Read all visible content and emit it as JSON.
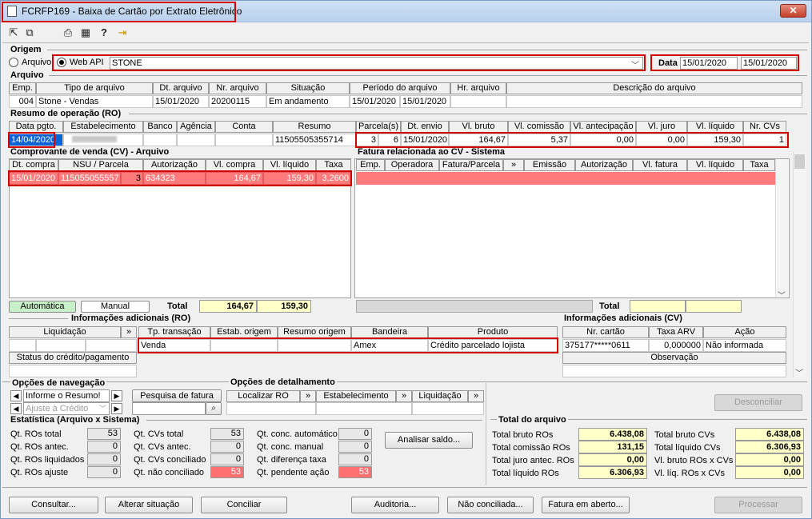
{
  "window": {
    "title": "FCRFP169 - Baixa de Cartão por Extrato Eletrônico",
    "close": "✕"
  },
  "toolbar": {
    "icons": [
      "export-icon",
      "copy-icon",
      "print-icon",
      "calendar-icon",
      "help-icon",
      "exit-icon"
    ]
  },
  "origem": {
    "label": "Origem",
    "opt_arquivo": "Arquivo",
    "opt_webapi": "Web API",
    "webapi_value": "STONE",
    "data_label": "Data",
    "data_from": "15/01/2020",
    "data_to": "15/01/2020"
  },
  "arquivo": {
    "label": "Arquivo",
    "headers": [
      "Emp.",
      "Tipo de arquivo",
      "Dt. arquivo",
      "Nr. arquivo",
      "Situação",
      "Período do arquivo",
      "Hr. arquivo",
      "Descrição do arquivo"
    ],
    "row": {
      "emp": "004",
      "tipo": "Stone - Vendas",
      "dt": "15/01/2020",
      "nr": "20200115",
      "situacao": "Em andamento",
      "periodo_de": "15/01/2020",
      "periodo_ate": "15/01/2020",
      "hr": "",
      "descricao": ""
    }
  },
  "resumo": {
    "label": "Resumo de operação (RO)",
    "headers": [
      "Data pgto.",
      "Estabelecimento",
      "Banco",
      "Agência",
      "Conta",
      "Resumo",
      "Parcela(s)",
      "Dt. envio",
      "Vl. bruto",
      "Vl. comissão",
      "Vl. antecipação",
      "Vl. juro",
      "Vl. líquido",
      "Nr. CVs"
    ],
    "row": {
      "data": "14/04/2020",
      "estab": "",
      "banco": "",
      "agencia": "",
      "conta": "",
      "resumo": "11505505355714",
      "parc1": "3",
      "parc2": "6",
      "envio": "15/01/2020",
      "bruto": "164,67",
      "comissao": "5,37",
      "antecipacao": "0,00",
      "juro": "0,00",
      "liquido": "159,30",
      "ncvs": "1"
    }
  },
  "cv": {
    "label": "Comprovante de venda (CV) - Arquivo",
    "headers": [
      "Dt. compra",
      "NSU / Parcela",
      "Autorização",
      "Vl. compra",
      "Vl. líquido",
      "Taxa"
    ],
    "row": {
      "compra": "15/01/2020",
      "nsu": "115055055557",
      "parcela": "3",
      "autorizacao": "634323",
      "vl_compra": "164,67",
      "vl_liquido": "159,30",
      "taxa": "3,2600"
    },
    "btn_auto": "Automática",
    "btn_manual": "Manual",
    "total_label": "Total",
    "total_compra": "164,67",
    "total_liquido": "159,30"
  },
  "fatura": {
    "label": "Fatura relacionada ao CV - Sistema",
    "headers": [
      "Emp.",
      "Operadora",
      "Fatura/Parcela",
      "»",
      "Emissão",
      "Autorização",
      "Vl. fatura",
      "Vl. líquido",
      "Taxa"
    ],
    "total_label": "Total"
  },
  "info_ro": {
    "label": "Informações adicionais (RO)",
    "headers": [
      "Liquidação",
      "»",
      "Tp. transação",
      "Estab. origem",
      "Resumo origem",
      "Bandeira",
      "Produto"
    ],
    "row": {
      "tp": "Venda",
      "bandeira": "Amex",
      "produto": "Crédito parcelado lojista"
    },
    "status_label": "Status do crédito/pagamento"
  },
  "info_cv": {
    "label": "Informações adicionais (CV)",
    "headers": [
      "Nr. cartão",
      "Taxa ARV",
      "Ação"
    ],
    "row": {
      "cartao": "375177*****0611",
      "taxa": "0,000000",
      "acao": "Não informada"
    },
    "obs_label": "Observação"
  },
  "nav": {
    "label": "Opções de navegação",
    "sel1": "Informe o Resumo!",
    "sel2": "Ajuste à Crédito",
    "pesquisa": "Pesquisa de fatura"
  },
  "detalhe": {
    "label": "Opções de detalhamento",
    "items": [
      "Localizar RO",
      "»",
      "Estabelecimento",
      "»",
      "Liquidação",
      "»"
    ]
  },
  "desconciliar": "Desconciliar",
  "estat": {
    "label": "Estatística (Arquivo x Sistema)",
    "col1": [
      {
        "l": "Qt. ROs total",
        "v": "53"
      },
      {
        "l": "Qt. ROs antec.",
        "v": "0"
      },
      {
        "l": "Qt. ROs liquidados",
        "v": "0"
      },
      {
        "l": "Qt. ROs ajuste",
        "v": "0"
      }
    ],
    "col2": [
      {
        "l": "Qt. CVs total",
        "v": "53"
      },
      {
        "l": "Qt. CVs antec.",
        "v": "0"
      },
      {
        "l": "Qt. CVs conciliado",
        "v": "0"
      },
      {
        "l": "Qt. não conciliado",
        "v": "53"
      }
    ],
    "col3": [
      {
        "l": "Qt. conc. automático",
        "v": "0"
      },
      {
        "l": "Qt. conc. manual",
        "v": "0"
      },
      {
        "l": "Qt. diferença taxa",
        "v": "0"
      },
      {
        "l": "Qt. pendente ação",
        "v": "53"
      }
    ],
    "analisar": "Analisar saldo..."
  },
  "total_arquivo": {
    "label": "Total do arquivo",
    "left": [
      {
        "l": "Total bruto ROs",
        "v": "6.438,08"
      },
      {
        "l": "Total comissão ROs",
        "v": "131,15"
      },
      {
        "l": "Total juro antec. ROs",
        "v": "0,00"
      },
      {
        "l": "Total líquido ROs",
        "v": "6.306,93"
      }
    ],
    "right": [
      {
        "l": "Total bruto CVs",
        "v": "6.438,08"
      },
      {
        "l": "Total líquido CVs",
        "v": "6.306,93"
      },
      {
        "l": "Vl. bruto ROs x CVs",
        "v": "0,00"
      },
      {
        "l": "Vl. líq. ROs x CVs",
        "v": "0,00"
      }
    ]
  },
  "buttons": {
    "consultar": "Consultar...",
    "alterar": "Alterar situação",
    "conciliar": "Conciliar",
    "auditoria": "Auditoria...",
    "nao_conciliada": "Não conciliada...",
    "fatura_aberto": "Fatura em aberto...",
    "processar": "Processar"
  }
}
